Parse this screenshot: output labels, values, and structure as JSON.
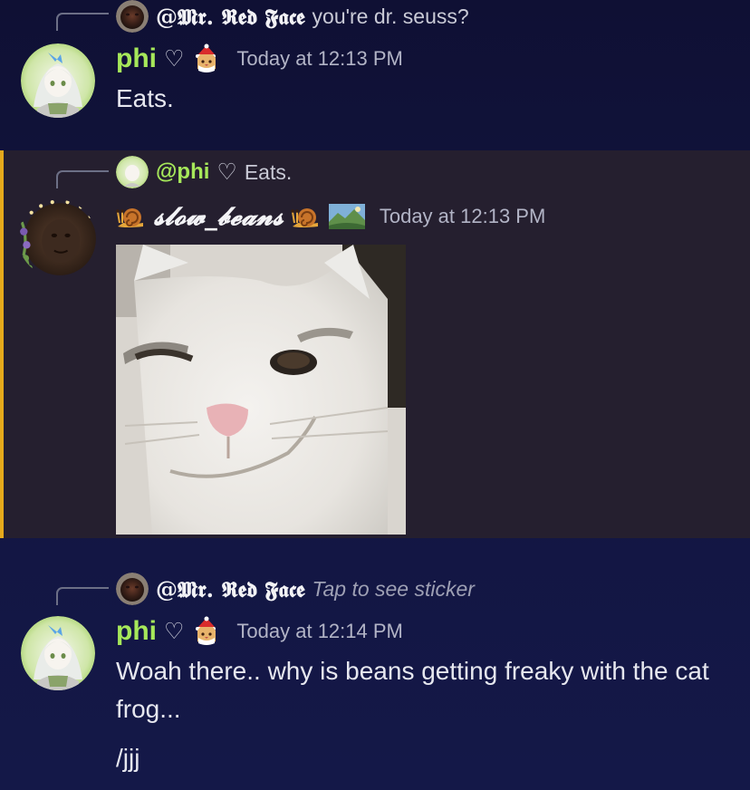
{
  "messages": [
    {
      "reply": {
        "author": "@𝕸𝖗. 𝕽𝖊𝖉 𝕱𝖆𝖈𝖊",
        "text": "you're dr. seuss?"
      },
      "author": "phi",
      "heart": "♡",
      "timestamp": "Today at 12:13 PM",
      "text": "Eats."
    },
    {
      "reply": {
        "author": "@phi",
        "heart": "♡",
        "text": "Eats."
      },
      "author": "𝓼𝓵𝓸𝔀_𝓫𝓮𝓪𝓷𝓼",
      "timestamp": "Today at 12:13 PM",
      "sticker": "white-cat-smirk-sticker"
    },
    {
      "reply": {
        "author": "@𝕸𝖗. 𝕽𝖊𝖉 𝕱𝖆𝖈𝖊",
        "text": "Tap to see sticker"
      },
      "author": "phi",
      "heart": "♡",
      "timestamp": "Today at 12:14 PM",
      "text": "Woah there.. why is beans getting freaky with the cat frog...",
      "text2": "/jjj"
    }
  ],
  "colors": {
    "background": "#121540",
    "highlight": "#251f2f",
    "highlight_bar": "#e5a91c",
    "phi_name": "#a6e85a"
  },
  "icons": [
    "cat-santa-badge-icon",
    "snail-icon",
    "landscape-badge-icon"
  ]
}
